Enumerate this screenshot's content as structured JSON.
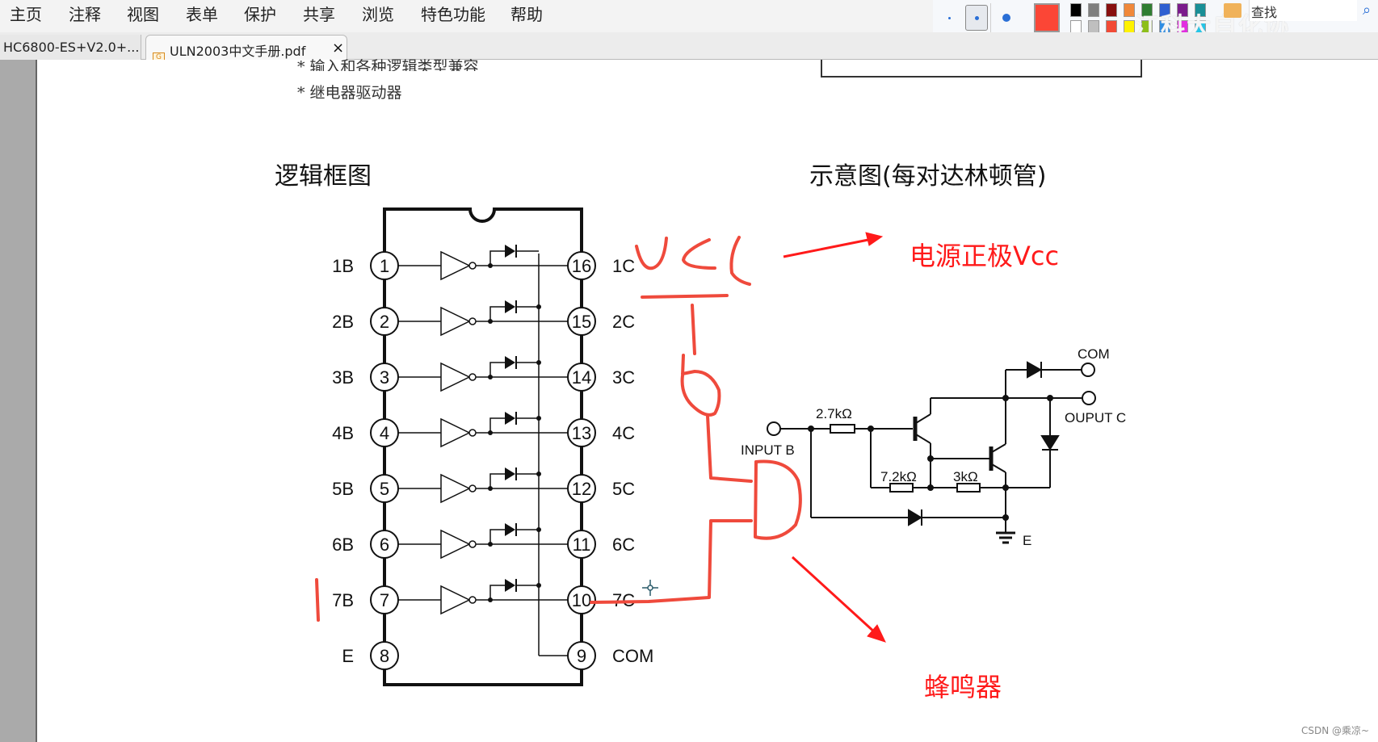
{
  "menubar": {
    "items": [
      "主页",
      "注释",
      "视图",
      "表单",
      "保护",
      "共享",
      "浏览",
      "特色功能",
      "帮助"
    ]
  },
  "drawbar": {
    "pen_sizes": [
      "small",
      "medium",
      "large"
    ],
    "selected_pen_size": "medium",
    "current_color": "#fb4636",
    "palette_row1": [
      "#000000",
      "#7f7f7f",
      "#880f0f",
      "#f0883a",
      "#2f7d32",
      "#2e5fd1",
      "#7a1b8c",
      "#198f97"
    ],
    "palette_row2": [
      "#ffffff",
      "#bfbfbf",
      "#f24a36",
      "#fff200",
      "#8dbf1a",
      "#2e8de4",
      "#e22ee0",
      "#22c6e8"
    ],
    "overlay_watermark": "江科大自化协",
    "find_label": "查找",
    "folder_icon": "folder-search-icon",
    "find_icon": "search-icon"
  },
  "tabs": [
    {
      "label": "HC6800-ES+V2.0+...",
      "active": false
    },
    {
      "label": "ULN2003中文手册.pdf",
      "active": true,
      "close": "×"
    }
  ],
  "document": {
    "bullet_lines": [
      "* 输入和各种逻辑类型兼容",
      "* 继电器驱动器"
    ],
    "logic_title": "逻辑框图",
    "schematic_title": "示意图(每对达林顿管)",
    "left_pins": [
      {
        "num": "1",
        "label": "1B"
      },
      {
        "num": "2",
        "label": "2B"
      },
      {
        "num": "3",
        "label": "3B"
      },
      {
        "num": "4",
        "label": "4B"
      },
      {
        "num": "5",
        "label": "5B"
      },
      {
        "num": "6",
        "label": "6B"
      },
      {
        "num": "7",
        "label": "7B"
      },
      {
        "num": "8",
        "label": "E"
      }
    ],
    "right_pins": [
      {
        "num": "16",
        "label": "1C"
      },
      {
        "num": "15",
        "label": "2C"
      },
      {
        "num": "14",
        "label": "3C"
      },
      {
        "num": "13",
        "label": "4C"
      },
      {
        "num": "12",
        "label": "5C"
      },
      {
        "num": "11",
        "label": "6C"
      },
      {
        "num": "10",
        "label": "7C"
      },
      {
        "num": "9",
        "label": "COM"
      }
    ],
    "darlington": {
      "input_label": "INPUT B",
      "r1": "2.7kΩ",
      "r2": "7.2kΩ",
      "r3": "3kΩ",
      "com_label": "COM",
      "output_label": "OUPUT C",
      "ground_label": "E"
    }
  },
  "annotations": {
    "vcc_handwritten": "VCC",
    "vcc_note": "电源正极Vcc",
    "buzzer_note": "蜂鸣器",
    "color": "#ff1a1a"
  },
  "footer": {
    "watermark": "CSDN @乘凉~"
  }
}
